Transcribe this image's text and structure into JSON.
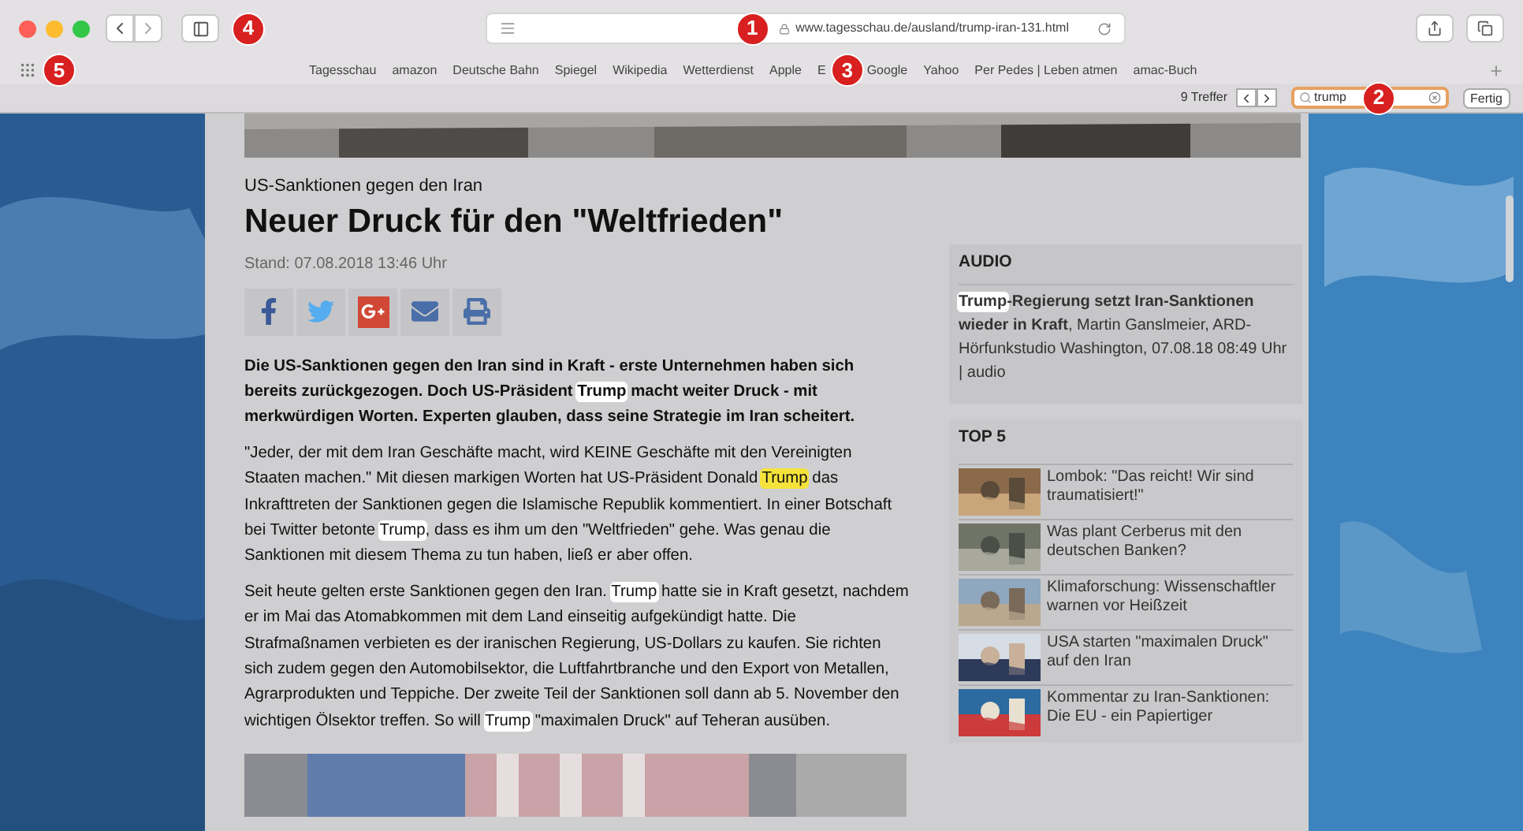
{
  "browser": {
    "url": "www.tagesschau.de/ausland/trump-iran-131.html",
    "bookmarks": [
      "Tagesschau",
      "amazon",
      "Deutsche Bahn",
      "Spiegel",
      "Wikipedia",
      "Wetterdienst",
      "Apple",
      "E",
      "Google",
      "Yahoo",
      "Per Pedes | Leben atmen",
      "amac-Buch"
    ]
  },
  "find_bar": {
    "count": "9 Treffer",
    "query": "trump",
    "done": "Fertig"
  },
  "callouts": [
    "1",
    "2",
    "3",
    "4",
    "5"
  ],
  "article": {
    "kicker": "US-Sanktionen gegen den Iran",
    "headline": "Neuer Druck für den \"Weltfrieden\"",
    "date": "Stand: 07.08.2018 13:46 Uhr",
    "share": [
      {
        "kind": "facebook"
      },
      {
        "kind": "twitter"
      },
      {
        "kind": "googleplus"
      },
      {
        "kind": "mail"
      },
      {
        "kind": "print"
      }
    ],
    "paragraphs": [
      {
        "kind": "lead",
        "segments": [
          {
            "text": "Die US-Sanktionen gegen den Iran sind in Kraft - erste Unternehmen haben sich bereits zurückgezogen. Doch US-Präsident ",
            "highlighted": false,
            "selected": false
          },
          {
            "text": "Trump",
            "highlighted": true,
            "selected": false
          },
          {
            "text": " macht weiter Druck - mit merkwürdigen Worten. Experten glauben, dass seine Strategie im Iran scheitert.",
            "highlighted": false,
            "selected": false
          }
        ]
      },
      {
        "kind": "body",
        "segments": [
          {
            "text": "\"Jeder, der mit dem Iran Geschäfte macht, wird KEINE Geschäfte mit den Vereinigten Staaten machen.\" Mit diesen markigen Worten hat US-Präsident Donald ",
            "highlighted": false,
            "selected": false
          },
          {
            "text": "Trump",
            "highlighted": true,
            "selected": true
          },
          {
            "text": " das Inkrafttreten der Sanktionen gegen die Islamische Republik kommentiert. In einer Botschaft bei Twitter betonte ",
            "highlighted": false,
            "selected": false
          },
          {
            "text": "Trump",
            "highlighted": true,
            "selected": false
          },
          {
            "text": ", dass es ihm um den \"Weltfrieden\" gehe. Was genau die Sanktionen mit diesem Thema zu tun haben, ließ er aber offen.",
            "highlighted": false,
            "selected": false
          }
        ]
      },
      {
        "kind": "body",
        "segments": [
          {
            "text": "Seit heute gelten erste Sanktionen gegen den Iran. ",
            "highlighted": false,
            "selected": false
          },
          {
            "text": "Trump",
            "highlighted": true,
            "selected": false
          },
          {
            "text": " hatte sie in Kraft gesetzt, nachdem er im Mai das Atomabkommen mit dem Land einseitig aufgekündigt hatte. Die Strafmaßnamen verbieten es der iranischen Regierung, US-Dollars zu kaufen. Sie richten sich zudem gegen den Automobilsektor, die Luftfahrtbranche und den Export von Metallen, Agrarprodukten und Teppiche. Der zweite Teil der Sanktionen soll dann ab 5. November den wichtigen Ölsektor treffen. So will ",
            "highlighted": false,
            "selected": false
          },
          {
            "text": "Trump",
            "highlighted": true,
            "selected": false
          },
          {
            "text": " \"maximalen Druck\" auf Teheran ausüben.",
            "highlighted": false,
            "selected": false
          }
        ]
      }
    ]
  },
  "sidebar": {
    "audio": {
      "title": "AUDIO",
      "segments": [
        {
          "text": "Trump",
          "highlighted": true,
          "selected": false,
          "bold": true
        },
        {
          "text": "-Regierung setzt Iran-Sanktionen wieder in Kraft",
          "highlighted": false,
          "selected": false,
          "bold": true
        },
        {
          "text": ", Martin Ganslmeier, ARD-Hörfunkstudio Washington, 07.08.18 08:49 Uhr | audio",
          "highlighted": false,
          "selected": false,
          "bold": false
        }
      ]
    },
    "top5": {
      "title": "TOP 5",
      "items": [
        "Lombok: \"Das reicht! Wir sind traumatisiert!\"",
        "Was plant Cerberus mit den deutschen Banken?",
        "Klimaforschung: Wissenschaftler warnen vor Heißzeit",
        "USA starten \"maximalen Druck\" auf den Iran",
        "Kommentar zu Iran-Sanktionen: Die EU - ein Papiertiger"
      ]
    }
  }
}
